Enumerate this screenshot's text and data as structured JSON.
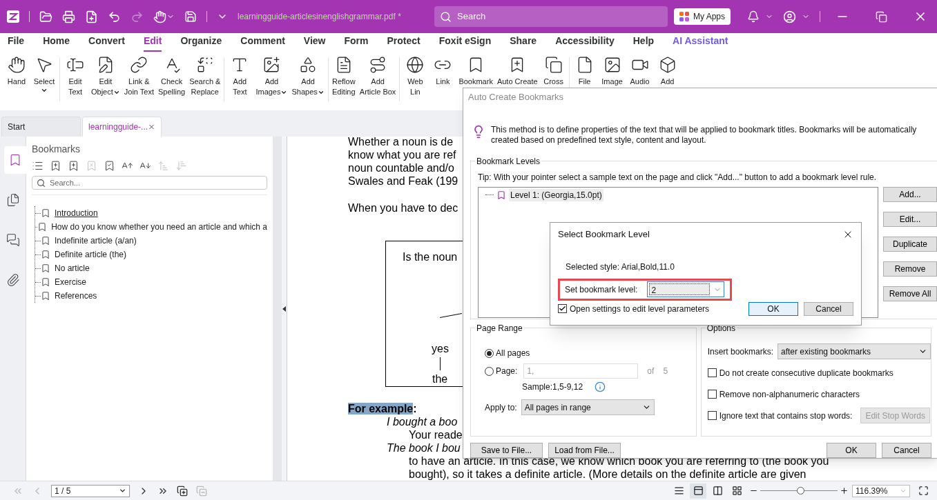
{
  "app": {
    "filename": "learningguide-articlesinenglishgrammar.pdf *",
    "search_placeholder": "Search",
    "apps_button": "My Apps"
  },
  "menu": [
    {
      "label": "File",
      "selected": false
    },
    {
      "label": "Home",
      "selected": false
    },
    {
      "label": "Convert",
      "selected": false
    },
    {
      "label": "Edit",
      "selected": true
    },
    {
      "label": "Organize",
      "selected": false
    },
    {
      "label": "Comment",
      "selected": false
    },
    {
      "label": "View",
      "selected": false
    },
    {
      "label": "Form",
      "selected": false
    },
    {
      "label": "Protect",
      "selected": false
    },
    {
      "label": "Foxit eSign",
      "selected": false
    },
    {
      "label": "Share",
      "selected": false
    },
    {
      "label": "Accessibility",
      "selected": false
    },
    {
      "label": "Help",
      "selected": false
    },
    {
      "label": "AI Assistant",
      "selected": false
    }
  ],
  "ribbon": [
    [
      {
        "lines": [
          "Hand"
        ],
        "has_menu": false
      },
      {
        "lines": [
          "Select"
        ],
        "has_menu": true
      }
    ],
    [
      {
        "lines": [
          "Edit",
          "Text"
        ],
        "has_menu": false
      },
      {
        "lines": [
          "Edit",
          "Object"
        ],
        "has_menu": true
      },
      {
        "lines": [
          "Link &",
          "Join Text"
        ],
        "has_menu": false
      },
      {
        "lines": [
          "Check",
          "Spelling"
        ],
        "has_menu": false
      },
      {
        "lines": [
          "Search &",
          "Replace"
        ],
        "has_menu": false
      }
    ],
    [
      {
        "lines": [
          "Add",
          "Text"
        ],
        "has_menu": false
      },
      {
        "lines": [
          "Add",
          "Images"
        ],
        "has_menu": true
      },
      {
        "lines": [
          "Add",
          "Shapes"
        ],
        "has_menu": true
      }
    ],
    [
      {
        "lines": [
          "Reflow",
          "Editing"
        ],
        "has_menu": false
      },
      {
        "lines": [
          "Add",
          "Article Box"
        ],
        "has_menu": false
      }
    ],
    [
      {
        "lines": [
          "Web",
          "Lin"
        ],
        "has_menu": false
      },
      {
        "lines": [
          "Link"
        ],
        "has_menu": false
      },
      {
        "lines": [
          "Bookmark"
        ],
        "has_menu": false
      },
      {
        "lines": [
          "Auto Create"
        ],
        "has_menu": false
      },
      {
        "lines": [
          "Cross"
        ],
        "has_menu": false
      }
    ],
    [
      {
        "lines": [
          "File"
        ],
        "has_menu": false
      },
      {
        "lines": [
          "Image"
        ],
        "has_menu": false
      },
      {
        "lines": [
          "Audio"
        ],
        "has_menu": false
      },
      {
        "lines": [
          "Add"
        ],
        "has_menu": false
      }
    ]
  ],
  "doc_tabs": [
    {
      "label": "Start",
      "selected": false
    },
    {
      "label": "learningguide-...",
      "selected": true
    }
  ],
  "side_nav": [
    {
      "selected": true
    },
    {
      "selected": false
    },
    {
      "selected": false
    },
    {
      "selected": false
    }
  ],
  "bookmarks_panel": {
    "title": "Bookmarks",
    "tools": [
      {
        "disabled": false
      },
      {
        "disabled": false
      },
      {
        "disabled": false
      },
      {
        "disabled": true
      },
      {
        "disabled": false
      },
      {
        "disabled": false
      },
      {
        "disabled": false
      },
      {
        "disabled": true
      },
      {
        "disabled": true
      }
    ],
    "search_placeholder": "Search...",
    "items": [
      {
        "label": "Introduction",
        "selected": true
      },
      {
        "label": "How do you know whether you need an article and which a",
        "selected": false
      },
      {
        "label": "Indefinite article (a/an)",
        "selected": false
      },
      {
        "label": "Definite article (the)",
        "selected": false
      },
      {
        "label": "No article",
        "selected": false
      },
      {
        "label": "Exercise",
        "selected": false
      },
      {
        "label": "References",
        "selected": false
      }
    ]
  },
  "document": {
    "paragraph": [
      "Whether a noun is de",
      "know what you are ref",
      "noun countable and/o",
      "Swales and Feak (199"
    ],
    "intro": "When you have to dec",
    "flowchart": {
      "question": "Is the noun",
      "branch": "yes",
      "answer": "the"
    },
    "example_heading": {
      "text": "For example",
      "suffix": ":"
    },
    "example_lines": [
      {
        "kind": "example",
        "text": "I bought a boo"
      },
      {
        "kind": "explanation",
        "text": "Your reade"
      },
      {
        "kind": "example",
        "text": "The book I bou"
      },
      {
        "kind": "explanation",
        "text": "to have an article. In this case, we know which book you are referring to (the book you"
      },
      {
        "kind": "explanation",
        "text": "bought), so it takes a definite article. (More details on the definite article are given"
      }
    ]
  },
  "auto_dialog": {
    "title": "Auto Create Bookmarks",
    "description": "This method is to define properties of the text that will be applied to bookmark titles. Bookmarks will be automatically created based on predefined text style, content and layout.",
    "levels_legend": "Bookmark Levels",
    "tip": "Tip: With your pointer select a sample text on the page and click \"Add...\" button to add a bookmark level rule.",
    "levels": [
      {
        "label": "Level 1: (Georgia,15.0pt)",
        "selected": true
      }
    ],
    "level_buttons": [
      "Add...",
      "Edit...",
      "Duplicate",
      "Remove",
      "Remove All"
    ],
    "page_range": {
      "legend": "Page Range",
      "options": [
        {
          "label": "All pages",
          "selected": true
        },
        {
          "label": "Page:",
          "selected": false
        }
      ],
      "page_value": "1,",
      "of_label": "of",
      "page_count": "5",
      "sample": "Sample:1,5-9,12",
      "apply_label": "Apply to:",
      "apply_value": "All pages in range"
    },
    "options": {
      "legend": "Options",
      "insert_label": "Insert bookmarks:",
      "insert_value": "after existing bookmarks",
      "checkboxes": [
        {
          "label": "Do not create consecutive duplicate bookmarks",
          "checked": false
        },
        {
          "label": "Remove non-alphanumeric characters",
          "checked": false
        },
        {
          "label": "Ignore text that contains stop words:",
          "checked": false
        }
      ],
      "stop_words_button": {
        "label": "Edit Stop Words",
        "disabled": true
      }
    },
    "footer_left": [
      "Save to File...",
      "Load from File..."
    ],
    "footer_right": [
      "OK",
      "Cancel"
    ]
  },
  "level_dialog": {
    "title": "Select Bookmark Level",
    "style": "Selected style: Arial,Bold,11.0",
    "level_label": "Set bookmark level:",
    "level_value": "2",
    "highlighted": true,
    "checkbox": {
      "label": "Open settings to edit level parameters",
      "checked": true
    },
    "buttons": [
      {
        "label": "OK",
        "default": true
      },
      {
        "label": "Cancel",
        "default": false
      }
    ]
  },
  "status_bar": {
    "nav_buttons": [
      {
        "disabled": true
      },
      {
        "disabled": true
      },
      {
        "disabled": false
      },
      {
        "disabled": false
      }
    ],
    "page": "1 / 5",
    "page_tools": [
      {
        "disabled": false
      },
      {
        "disabled": true
      }
    ],
    "views": [
      {
        "selected": false
      },
      {
        "selected": true
      },
      {
        "selected": false
      },
      {
        "selected": false
      }
    ],
    "zoom": {
      "level": 0.52,
      "value": "116.39%"
    }
  }
}
